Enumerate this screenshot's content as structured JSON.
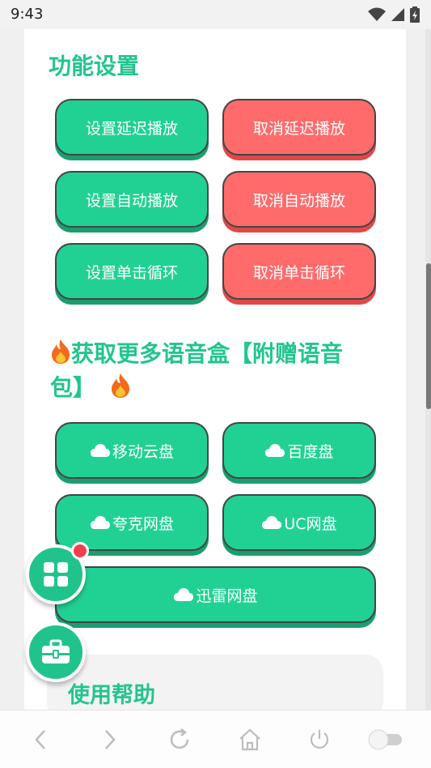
{
  "status_bar": {
    "time": "9:43"
  },
  "settings": {
    "title": "功能设置",
    "buttons": [
      {
        "label": "设置延迟播放"
      },
      {
        "label": "取消延迟播放"
      },
      {
        "label": "设置自动播放"
      },
      {
        "label": "取消自动播放"
      },
      {
        "label": "设置单击循环"
      },
      {
        "label": "取消单击循环"
      }
    ]
  },
  "downloads": {
    "title_line1": "获取更多语音盒【附赠语音",
    "title_line2": "包】",
    "buttons": [
      {
        "label": "移动云盘"
      },
      {
        "label": "百度盘"
      },
      {
        "label": "夸克网盘"
      },
      {
        "label": "UC网盘"
      },
      {
        "label": "迅雷网盘"
      }
    ]
  },
  "help": {
    "title": "使用帮助"
  },
  "colors": {
    "accent": "#21d193",
    "danger": "#ff6b6b",
    "title": "#22c58d"
  }
}
